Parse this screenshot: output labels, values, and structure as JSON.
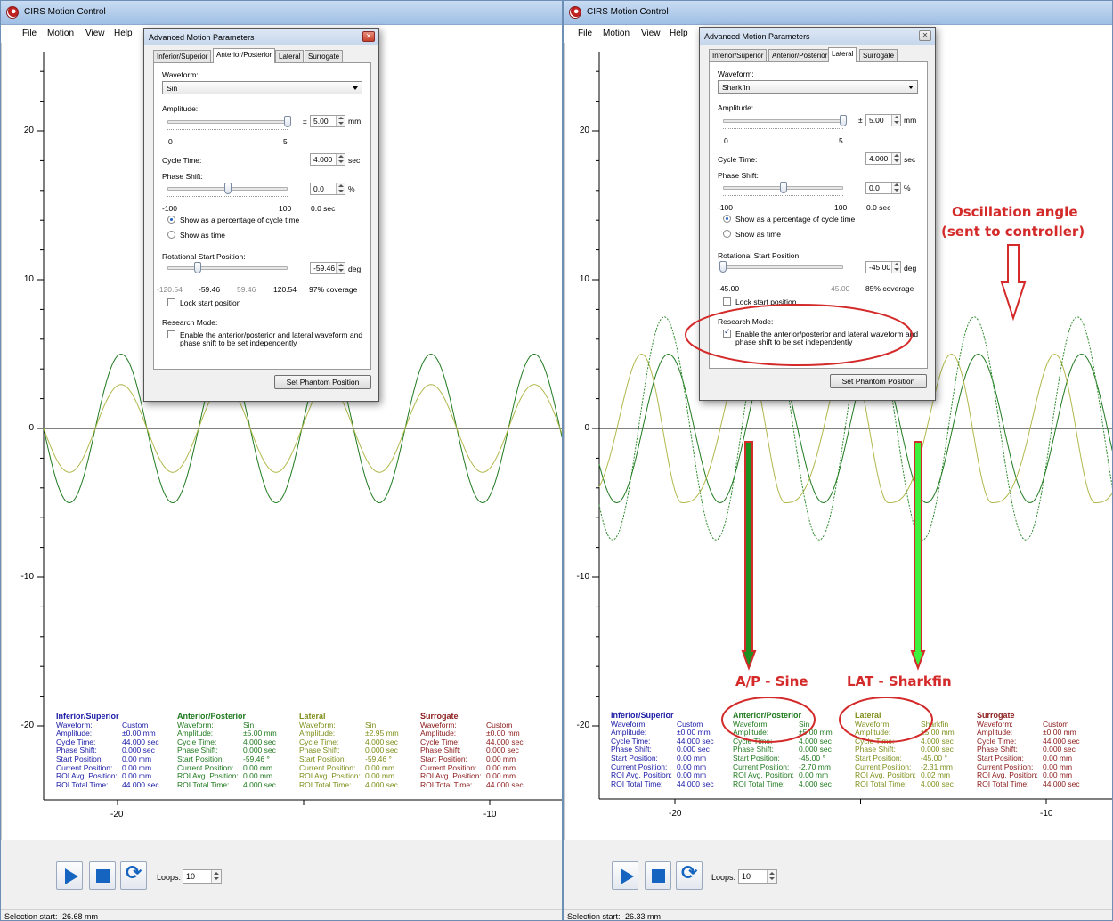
{
  "app_title": "CIRS Motion Control",
  "menu": [
    "File",
    "Motion",
    "View",
    "Help"
  ],
  "axis": {
    "y_ticks": [
      "20",
      "10",
      "0",
      "-10",
      "-20"
    ],
    "x_ticks": [
      "-20",
      "-10"
    ]
  },
  "colors": {
    "inferior_superior": "#1a1aa6",
    "anterior_posterior": "#1f7a1f",
    "lateral": "#7f8f1a",
    "surrogate": "#8b1a1a",
    "annotation": "#d42a2a"
  },
  "info_labels": [
    "Waveform:",
    "Amplitude:",
    "Cycle Time:",
    "Phase Shift:",
    "Start Position:",
    "Current Position:",
    "ROI Avg. Position:",
    "ROI Total Time:"
  ],
  "dialog": {
    "title": "Advanced Motion Parameters",
    "tabs": [
      "Inferior/Superior",
      "Anterior/Posterior",
      "Lateral",
      "Surrogate"
    ],
    "waveform_label": "Waveform:",
    "amplitude_label": "Amplitude:",
    "amplitude_pm": "±",
    "amplitude_unit": "mm",
    "amp_min": "0",
    "amp_max": "5",
    "cycle_label": "Cycle Time:",
    "cycle_unit": "sec",
    "phase_label": "Phase Shift:",
    "phase_unit": "%",
    "phase_min": "-100",
    "phase_max": "100",
    "phase_sec": "0.0 sec",
    "radio_percent": "Show as a percentage of cycle time",
    "radio_time": "Show as time",
    "rot_label": "Rotational Start Position:",
    "rot_unit": "deg",
    "lock_label": "Lock start position",
    "research_label": "Research Mode:",
    "research_text_1": "Enable the anterior/posterior and lateral waveform and",
    "research_text_2": "phase shift to be set independently",
    "set_button": "Set Phantom Position"
  },
  "left": {
    "dialog": {
      "active_tab": "Anterior/Posterior",
      "waveform": "Sin",
      "amplitude": "5.00",
      "amplitude_level": 1.0,
      "cycle_time": "4.000",
      "phase_shift": "0.0",
      "phase_level": 0.5,
      "rot_value": "-59.46",
      "rot_level": 0.253,
      "rot_min": "-120.54",
      "rot_a": "-59.46",
      "rot_b": "59.46",
      "rot_max": "120.54",
      "coverage": "97% coverage",
      "research_mode": false
    },
    "info": [
      {
        "title": "Inferior/Superior",
        "values": [
          "Custom",
          "±0.00 mm",
          "44.000 sec",
          "0.000 sec",
          "0.00 mm",
          "0.00 mm",
          "0.00 mm",
          "44.000 sec"
        ]
      },
      {
        "title": "Anterior/Posterior",
        "values": [
          "Sin",
          "±5.00 mm",
          "4.000 sec",
          "0.000 sec",
          "-59.46 °",
          "0.00 mm",
          "0.00 mm",
          "4.000 sec"
        ]
      },
      {
        "title": "Lateral",
        "values": [
          "Sin",
          "±2.95 mm",
          "4.000 sec",
          "0.000 sec",
          "-59.46 °",
          "0.00 mm",
          "0.00 mm",
          "4.000 sec"
        ]
      },
      {
        "title": "Surrogate",
        "values": [
          "Custom",
          "±0.00 mm",
          "44.000 sec",
          "0.000 sec",
          "0.00 mm",
          "0.00 mm",
          "0.00 mm",
          "44.000 sec"
        ]
      }
    ],
    "loops_label": "Loops:",
    "loops": "10",
    "status": "Selection start: -26.68 mm"
  },
  "right": {
    "dialog": {
      "active_tab": "Lateral",
      "waveform": "Sharkfin",
      "amplitude": "5.00",
      "amplitude_level": 1.0,
      "cycle_time": "4.000",
      "phase_shift": "0.0",
      "phase_level": 0.5,
      "rot_value": "-45.00",
      "rot_level": 0.0,
      "rot_min": "-45.00",
      "rot_a": "",
      "rot_b": "",
      "rot_max": "45.00",
      "coverage": "85% coverage",
      "research_mode": true
    },
    "info": [
      {
        "title": "Inferior/Superior",
        "values": [
          "Custom",
          "±0.00 mm",
          "44.000 sec",
          "0.000 sec",
          "0.00 mm",
          "0.00 mm",
          "0.00 mm",
          "44.000 sec"
        ]
      },
      {
        "title": "Anterior/Posterior",
        "values": [
          "Sin",
          "±5.00 mm",
          "4.000 sec",
          "0.000 sec",
          "-45.00 °",
          "-2.70 mm",
          "0.00 mm",
          "4.000 sec"
        ]
      },
      {
        "title": "Lateral",
        "values": [
          "Sharkfin",
          "±5.00 mm",
          "4.000 sec",
          "0.000 sec",
          "-45.00 °",
          "-2.31 mm",
          "0.02 mm",
          "4.000 sec"
        ]
      },
      {
        "title": "Surrogate",
        "values": [
          "Custom",
          "±0.00 mm",
          "44.000 sec",
          "0.000 sec",
          "0.00 mm",
          "0.00 mm",
          "0.00 mm",
          "44.000 sec"
        ]
      }
    ],
    "loops_label": "Loops:",
    "loops": "10",
    "status": "Selection start: -26.33 mm"
  },
  "annotations": {
    "oscillation_1": "Oscillation angle",
    "oscillation_2": "(sent to controller)",
    "ap_label": "A/P - Sine",
    "lat_label": "LAT - Sharkfin"
  }
}
